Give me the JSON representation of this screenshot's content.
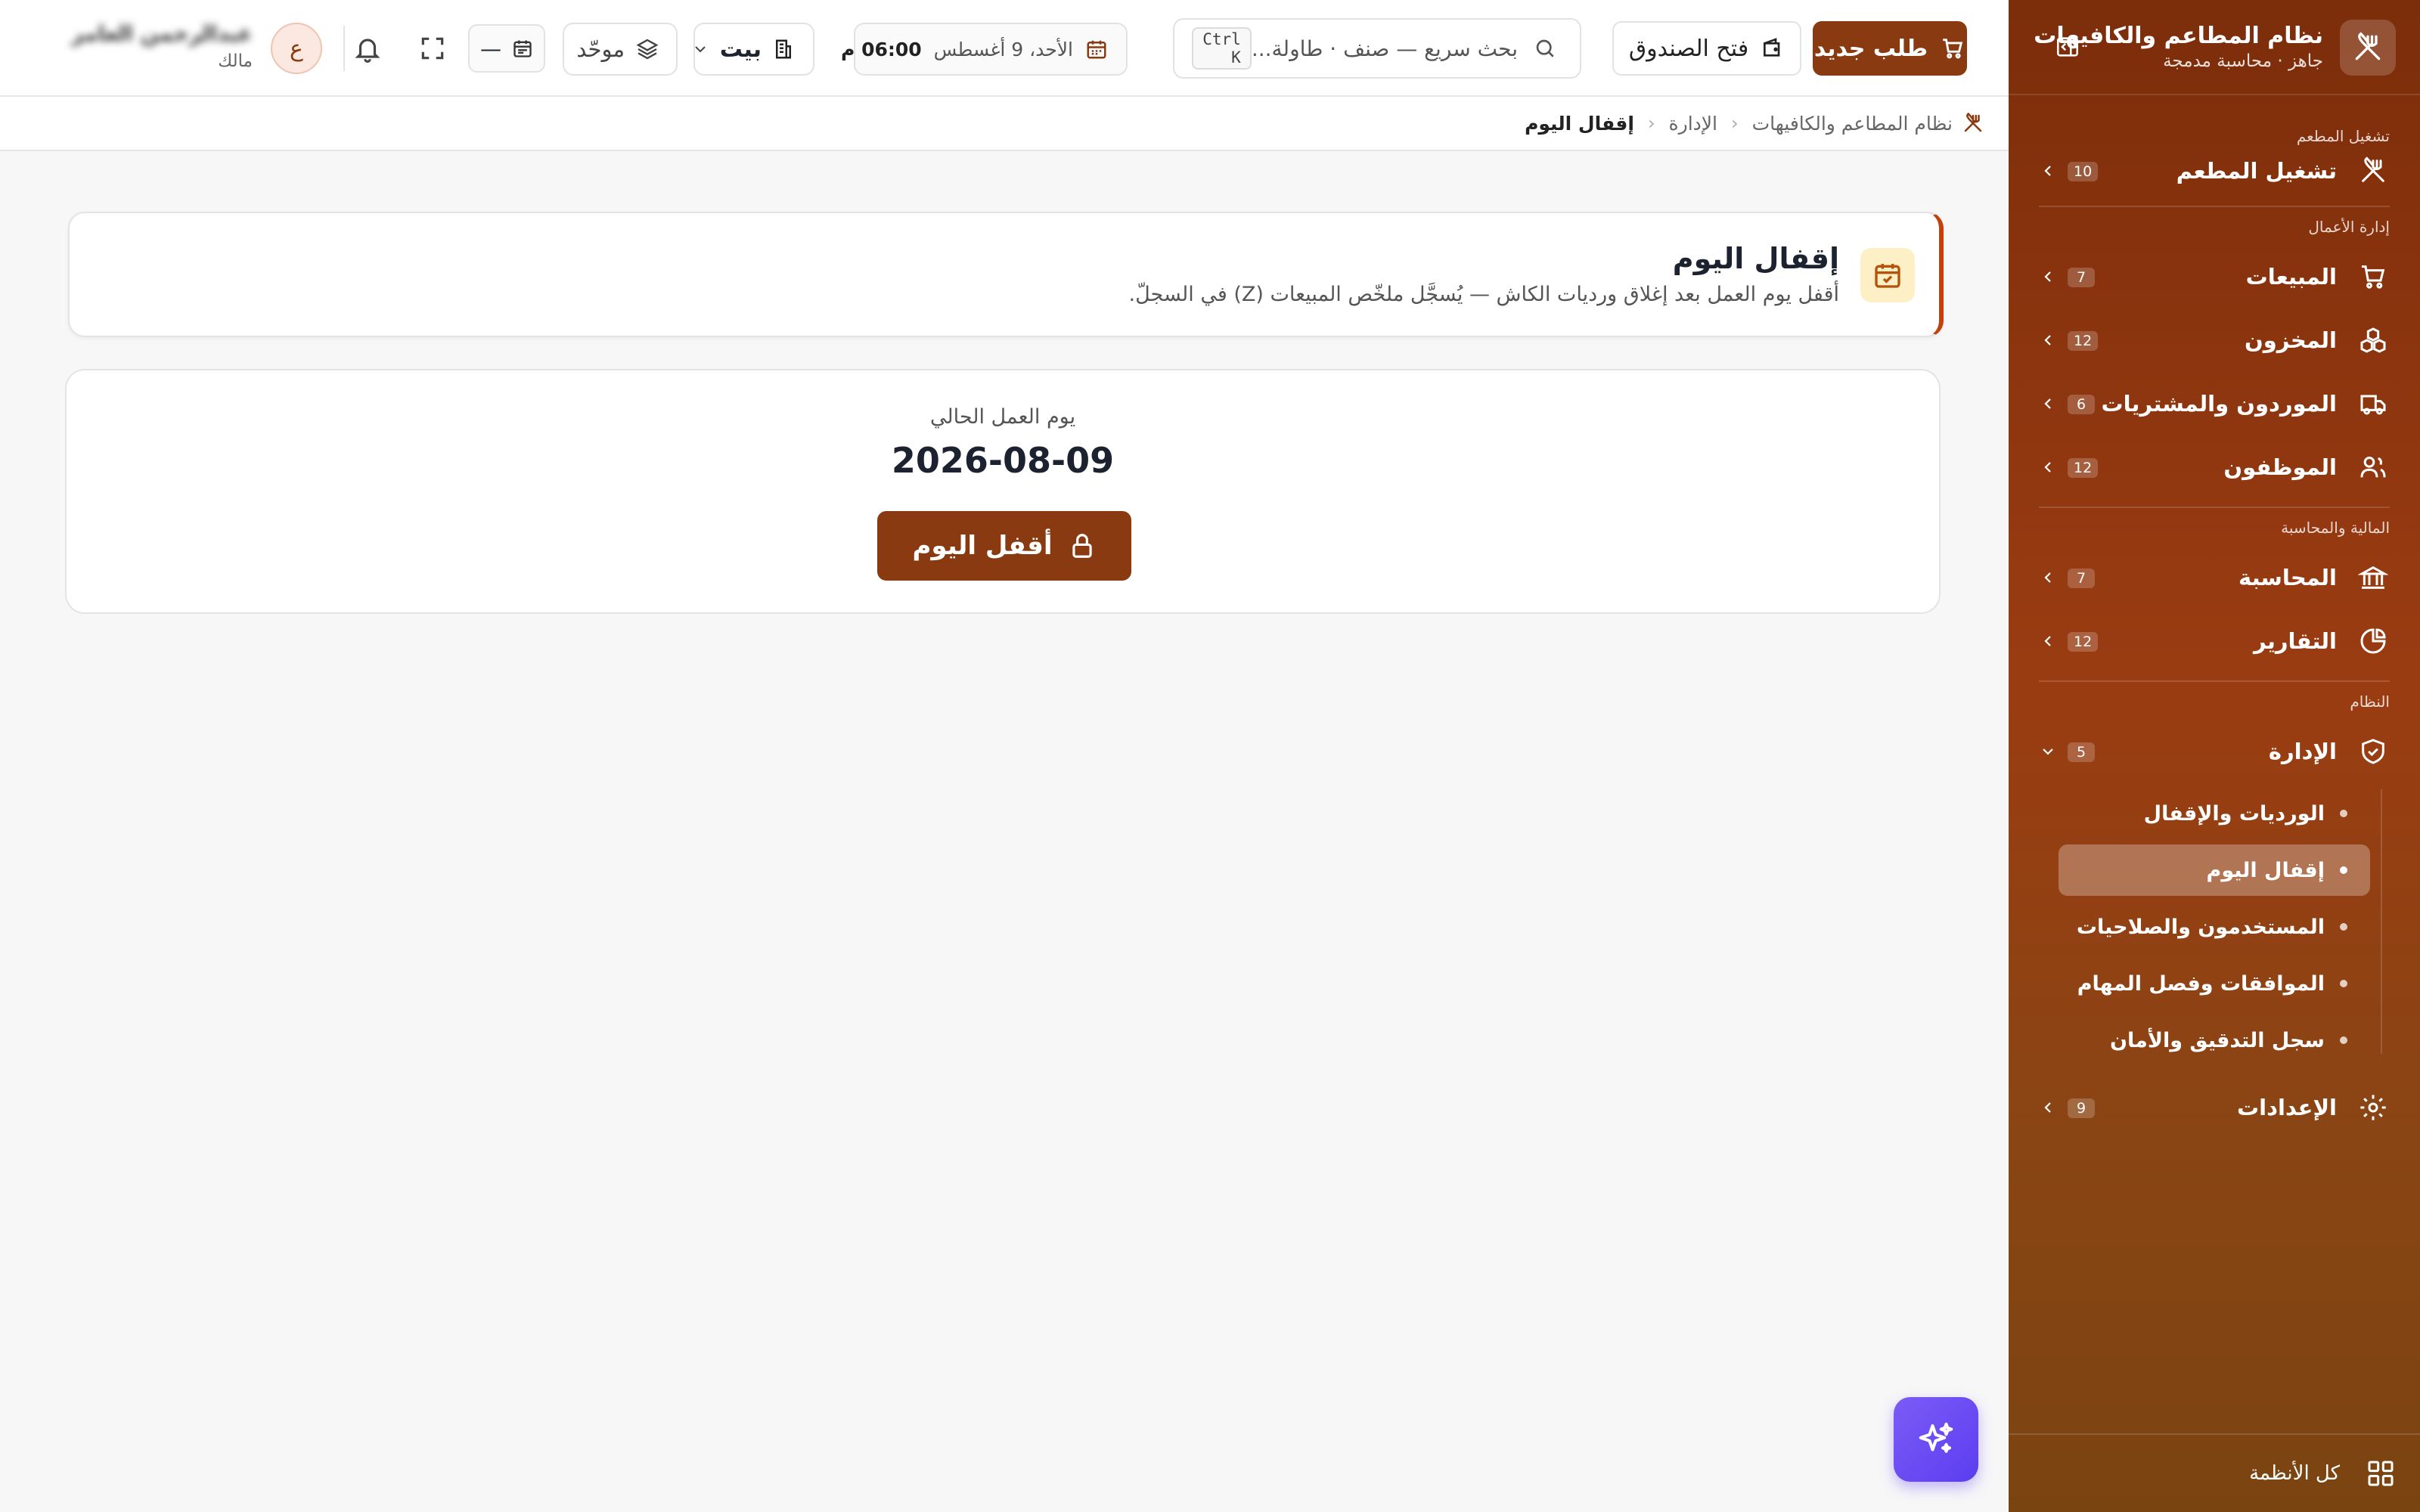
{
  "sidebar": {
    "title": "نظام المطاعم والكافيهات",
    "subtitle": "جاهز · محاسبة مدمجة",
    "sections": {
      "ops": "تشغيل المطعم",
      "business": "إدارة الأعمال",
      "finance": "المالية والمحاسبة",
      "system": "النظام"
    },
    "items": {
      "restaurant": {
        "label": "تشغيل المطعم",
        "count": "10"
      },
      "sales": {
        "label": "المبيعات",
        "count": "7"
      },
      "inventory": {
        "label": "المخزون",
        "count": "12"
      },
      "suppliers": {
        "label": "الموردون والمشتريات",
        "count": "6"
      },
      "employees": {
        "label": "الموظفون",
        "count": "12"
      },
      "accounting": {
        "label": "المحاسبة",
        "count": "7"
      },
      "reports": {
        "label": "التقارير",
        "count": "12"
      },
      "admin": {
        "label": "الإدارة",
        "count": "5"
      },
      "settings": {
        "label": "الإعدادات",
        "count": "9"
      }
    },
    "admin_sub": [
      {
        "label": "الورديات والإقفال"
      },
      {
        "label": "إقفال اليوم"
      },
      {
        "label": "المستخدمون والصلاحيات"
      },
      {
        "label": "الموافقات وفصل المهام"
      },
      {
        "label": "سجل التدقيق والأمان"
      }
    ],
    "footer": "كل الأنظمة"
  },
  "topbar": {
    "new_order": "طلب جديد",
    "open_cashbox": "فتح الصندوق",
    "search_placeholder": "بحث سريع — صنف · طاولة...",
    "search_shortcut": "Ctrl K",
    "date": "الأحد، 9 أغسطس",
    "time": "06:00 م",
    "branch": "بيت",
    "scope": "موحّد",
    "period": "—",
    "avatar_letter": "ع",
    "user_name": "عبدالرحمن العامر",
    "user_role": "مالك"
  },
  "breadcrumb": {
    "root": "نظام المطاعم والكافيهات",
    "section": "الإدارة",
    "current": "إقفال اليوم"
  },
  "page": {
    "title": "إقفال اليوم",
    "description": "أقفل يوم العمل بعد إغلاق ورديات الكاش — يُسجَّل ملخّص المبيعات (Z) في السجلّ.",
    "day_label": "يوم العمل الحالي",
    "day_value": "2026-08-09",
    "close_button": "أقفل اليوم"
  },
  "colors": {
    "brand": "#8a3a10",
    "sidebar_top": "#7c2d0a",
    "accent_border": "#c2410c",
    "fab": "#6b4cf3"
  }
}
